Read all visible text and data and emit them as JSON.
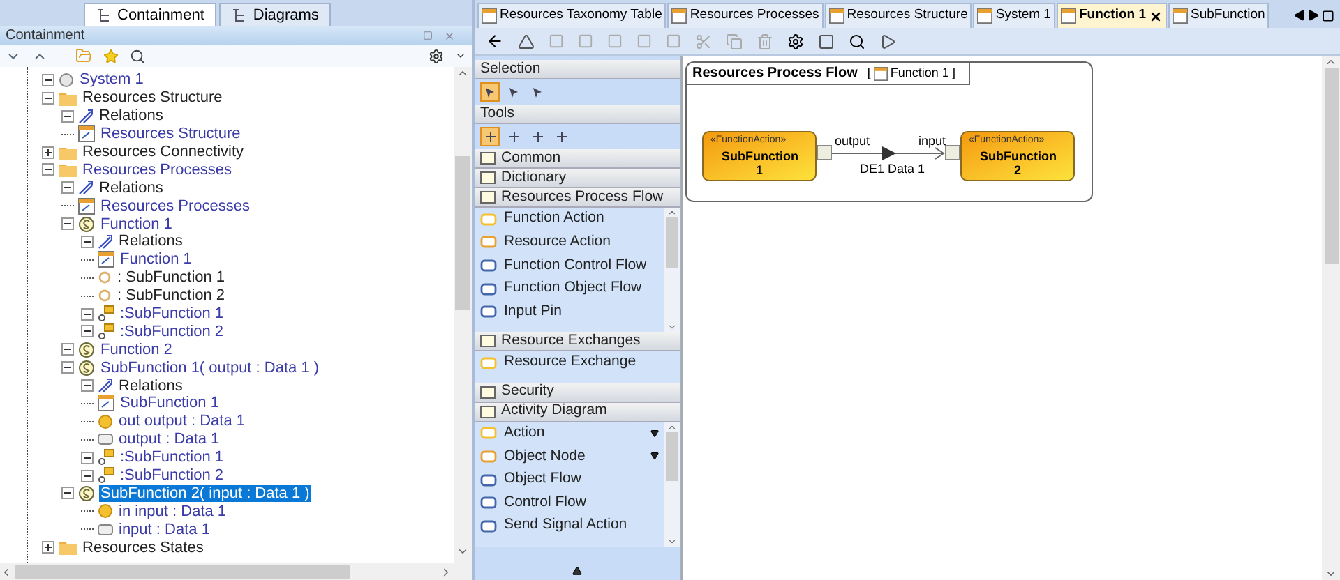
{
  "left_tabs": [
    {
      "label": "Containment",
      "selected": true
    },
    {
      "label": "Diagrams",
      "selected": false
    }
  ],
  "panel": {
    "title": "Containment"
  },
  "tree": [
    {
      "label": "System 1",
      "kind": "system",
      "linked": true,
      "expanded": true
    },
    {
      "label": "Resources Structure",
      "kind": "folder",
      "linked": false,
      "expanded": true,
      "children": [
        {
          "label": "Relations",
          "kind": "relations",
          "linked": false,
          "expanded": true
        },
        {
          "label": "Resources Structure",
          "kind": "diagram",
          "linked": true
        }
      ]
    },
    {
      "label": "Resources Connectivity",
      "kind": "folder",
      "linked": false,
      "expanded": false
    },
    {
      "label": "Resources Processes",
      "kind": "folder",
      "linked": true,
      "expanded": true,
      "children": [
        {
          "label": "Relations",
          "kind": "relations",
          "linked": false,
          "expanded": true
        },
        {
          "label": "Resources Processes",
          "kind": "diagram",
          "linked": true
        },
        {
          "label": "Function 1",
          "kind": "function",
          "linked": true,
          "expanded": true,
          "children": [
            {
              "label": "Relations",
              "kind": "relations",
              "linked": false,
              "expanded": true
            },
            {
              "label": "Function 1",
              "kind": "diagram",
              "linked": true
            },
            {
              "label": ": SubFunction 1",
              "kind": "ring",
              "linked": false
            },
            {
              "label": ": SubFunction 2",
              "kind": "ring",
              "linked": false
            },
            {
              "label": ":SubFunction 1",
              "kind": "action",
              "linked": true,
              "expanded": true
            },
            {
              "label": ":SubFunction 2",
              "kind": "action",
              "linked": true,
              "expanded": true
            }
          ]
        },
        {
          "label": "Function 2",
          "kind": "function",
          "linked": true,
          "expanded": true
        },
        {
          "label": "SubFunction 1( output : Data 1 )",
          "kind": "function",
          "linked": true,
          "expanded": true,
          "children": [
            {
              "label": "Relations",
              "kind": "relations",
              "linked": false,
              "expanded": true
            },
            {
              "label": "SubFunction 1",
              "kind": "diagram",
              "linked": true
            },
            {
              "label": "out output : Data 1",
              "kind": "dot",
              "linked": true
            },
            {
              "label": "output : Data 1",
              "kind": "pin",
              "linked": true
            },
            {
              "label": ":SubFunction 1",
              "kind": "action",
              "linked": true,
              "expanded": true
            },
            {
              "label": ":SubFunction 2",
              "kind": "action",
              "linked": true,
              "expanded": true
            }
          ]
        },
        {
          "label": "SubFunction 2( input : Data 1 )",
          "kind": "function",
          "expanded": true,
          "selected": true,
          "children": [
            {
              "label": "in input : Data 1",
              "kind": "dot",
              "linked": true
            },
            {
              "label": "input : Data 1",
              "kind": "pin",
              "linked": true
            }
          ]
        }
      ]
    },
    {
      "label": "Resources States",
      "kind": "folder",
      "linked": false,
      "expanded": false
    }
  ],
  "editor_tabs": [
    {
      "label": "Resources Taxonomy Table",
      "selected": false
    },
    {
      "label": "Resources Processes",
      "selected": false
    },
    {
      "label": "Resources Structure",
      "selected": false
    },
    {
      "label": "System 1",
      "selected": false
    },
    {
      "label": "Function 1",
      "selected": true
    },
    {
      "label": "SubFunction",
      "selected": false
    }
  ],
  "palette": {
    "selection_tools": [
      {
        "selected": true
      },
      {
        "selected": false
      },
      {
        "selected": false
      }
    ],
    "tools": [
      {
        "selected": true
      },
      {
        "selected": false
      },
      {
        "selected": false
      },
      {
        "selected": false
      }
    ],
    "sections": [
      {
        "title": "Selection",
        "kind": "selection"
      },
      {
        "title": "Tools",
        "kind": "tools"
      },
      {
        "title": "Common",
        "kind": "group"
      },
      {
        "title": "Dictionary",
        "kind": "group"
      },
      {
        "title": "Resources Process Flow",
        "kind": "group",
        "items": [
          {
            "label": "Function Action"
          },
          {
            "label": "Resource Action"
          },
          {
            "label": "Function Control Flow"
          },
          {
            "label": "Function Object Flow"
          },
          {
            "label": "Input Pin"
          }
        ]
      },
      {
        "title": "Resource Exchanges",
        "kind": "group",
        "items": [
          {
            "label": "Resource Exchange"
          }
        ]
      },
      {
        "title": "Security",
        "kind": "group"
      },
      {
        "title": "Activity Diagram",
        "kind": "group",
        "items": [
          {
            "label": "Action",
            "menu": true
          },
          {
            "label": "Object Node",
            "menu": true
          },
          {
            "label": "Object Flow"
          },
          {
            "label": "Control Flow"
          },
          {
            "label": "Send Signal Action"
          }
        ]
      }
    ]
  },
  "diagram": {
    "frame_kind": "Resources Process Flow",
    "frame_open": "[",
    "frame_name": "Function 1",
    "frame_close": "]",
    "nodes": [
      {
        "stereotype": "«FunctionAction»",
        "name": "SubFunction 1"
      },
      {
        "stereotype": "«FunctionAction»",
        "name": "SubFunction 2"
      }
    ],
    "flow": {
      "source_pin": "output",
      "target_pin": "input",
      "label": "DE1 Data 1"
    }
  }
}
